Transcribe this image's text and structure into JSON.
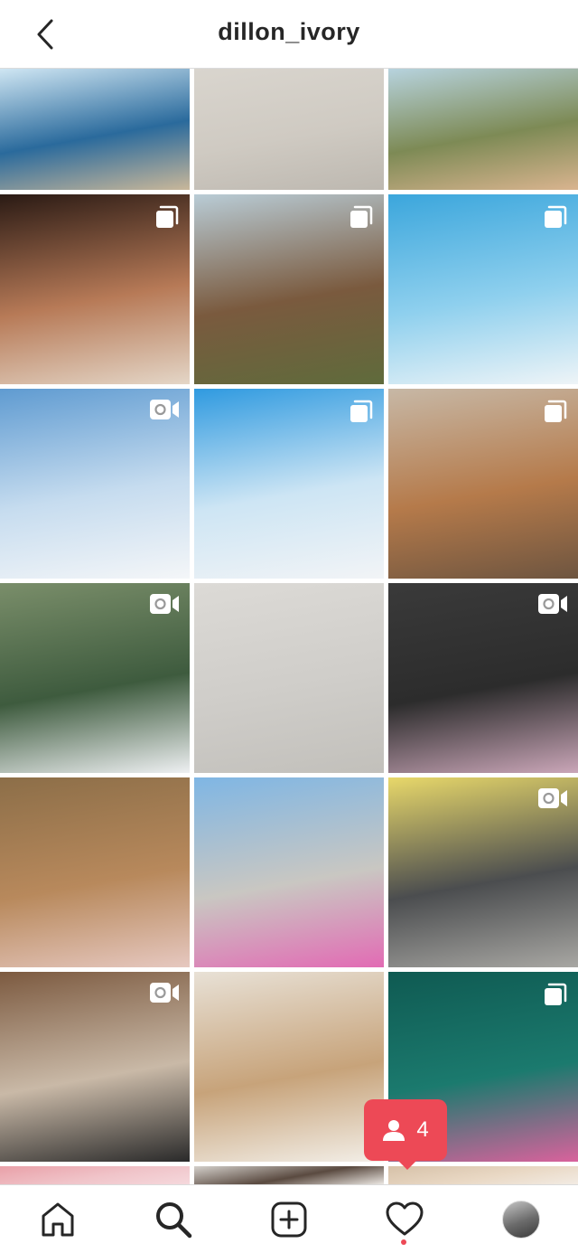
{
  "header": {
    "username": "dillon_ivory",
    "back_icon": "chevron-left-icon"
  },
  "posts": [
    {
      "badge": "",
      "colors": [
        "#cfe6f3",
        "#2a6a9c",
        "#c9b79a"
      ]
    },
    {
      "badge": "",
      "colors": [
        "#d9d5ce",
        "#cfcac2",
        "#bdb8b0"
      ]
    },
    {
      "badge": "",
      "colors": [
        "#b7d3de",
        "#7d8a55",
        "#d9b48f"
      ]
    },
    {
      "badge": "carousel",
      "colors": [
        "#2a1a14",
        "#b77a57",
        "#e4d6c7"
      ]
    },
    {
      "badge": "carousel",
      "colors": [
        "#b9ccd6",
        "#7a5a3e",
        "#5f6b3c"
      ]
    },
    {
      "badge": "carousel",
      "colors": [
        "#3ba6dc",
        "#8fd0ee",
        "#eef4f7"
      ]
    },
    {
      "badge": "video",
      "colors": [
        "#5f9bd1",
        "#c6dcef",
        "#f4f6f8"
      ]
    },
    {
      "badge": "carousel",
      "colors": [
        "#2f9ae0",
        "#cde5f4",
        "#f2f4f6"
      ]
    },
    {
      "badge": "carousel",
      "colors": [
        "#c7b8a6",
        "#b57a4a",
        "#6e5540"
      ]
    },
    {
      "badge": "video",
      "colors": [
        "#7a8e6a",
        "#3e5b3e",
        "#eef0f2"
      ]
    },
    {
      "badge": "",
      "colors": [
        "#dcdad6",
        "#cfcdc9",
        "#c2c0bb"
      ]
    },
    {
      "badge": "video",
      "colors": [
        "#3a3a3a",
        "#2c2c2c",
        "#caa6b8"
      ]
    },
    {
      "badge": "",
      "colors": [
        "#8c6e48",
        "#b8895c",
        "#e6c8c0"
      ]
    },
    {
      "badge": "",
      "colors": [
        "#7fb6e4",
        "#c9c7c2",
        "#e26bb4"
      ]
    },
    {
      "badge": "video",
      "colors": [
        "#e8d86a",
        "#4b4d4f",
        "#a8a7a3"
      ]
    },
    {
      "badge": "video",
      "colors": [
        "#7c5a40",
        "#c9b9a7",
        "#2a2a2a"
      ]
    },
    {
      "badge": "",
      "colors": [
        "#e8e1d6",
        "#c7a37a",
        "#f3efe8"
      ]
    },
    {
      "badge": "carousel",
      "colors": [
        "#0f5a52",
        "#1b7a6e",
        "#d9629c"
      ]
    },
    {
      "badge": "",
      "colors": [
        "#e9a0a8",
        "#f0c4c9",
        "#f5d8dc"
      ]
    },
    {
      "badge": "",
      "colors": [
        "#d4d0cb",
        "#5a4a40",
        "#ebe7e2"
      ]
    },
    {
      "badge": "",
      "colors": [
        "#d6c1a8",
        "#e9d8c4",
        "#f2ebe3"
      ]
    }
  ],
  "notification_toast": {
    "icon": "person-icon",
    "count": "4"
  },
  "tabbar": {
    "items": [
      {
        "name": "home",
        "icon": "home-icon"
      },
      {
        "name": "search",
        "icon": "search-icon"
      },
      {
        "name": "new-post",
        "icon": "plus-square-icon"
      },
      {
        "name": "activity",
        "icon": "heart-icon"
      },
      {
        "name": "profile",
        "icon": "avatar"
      }
    ],
    "accent": "#ed4956"
  }
}
